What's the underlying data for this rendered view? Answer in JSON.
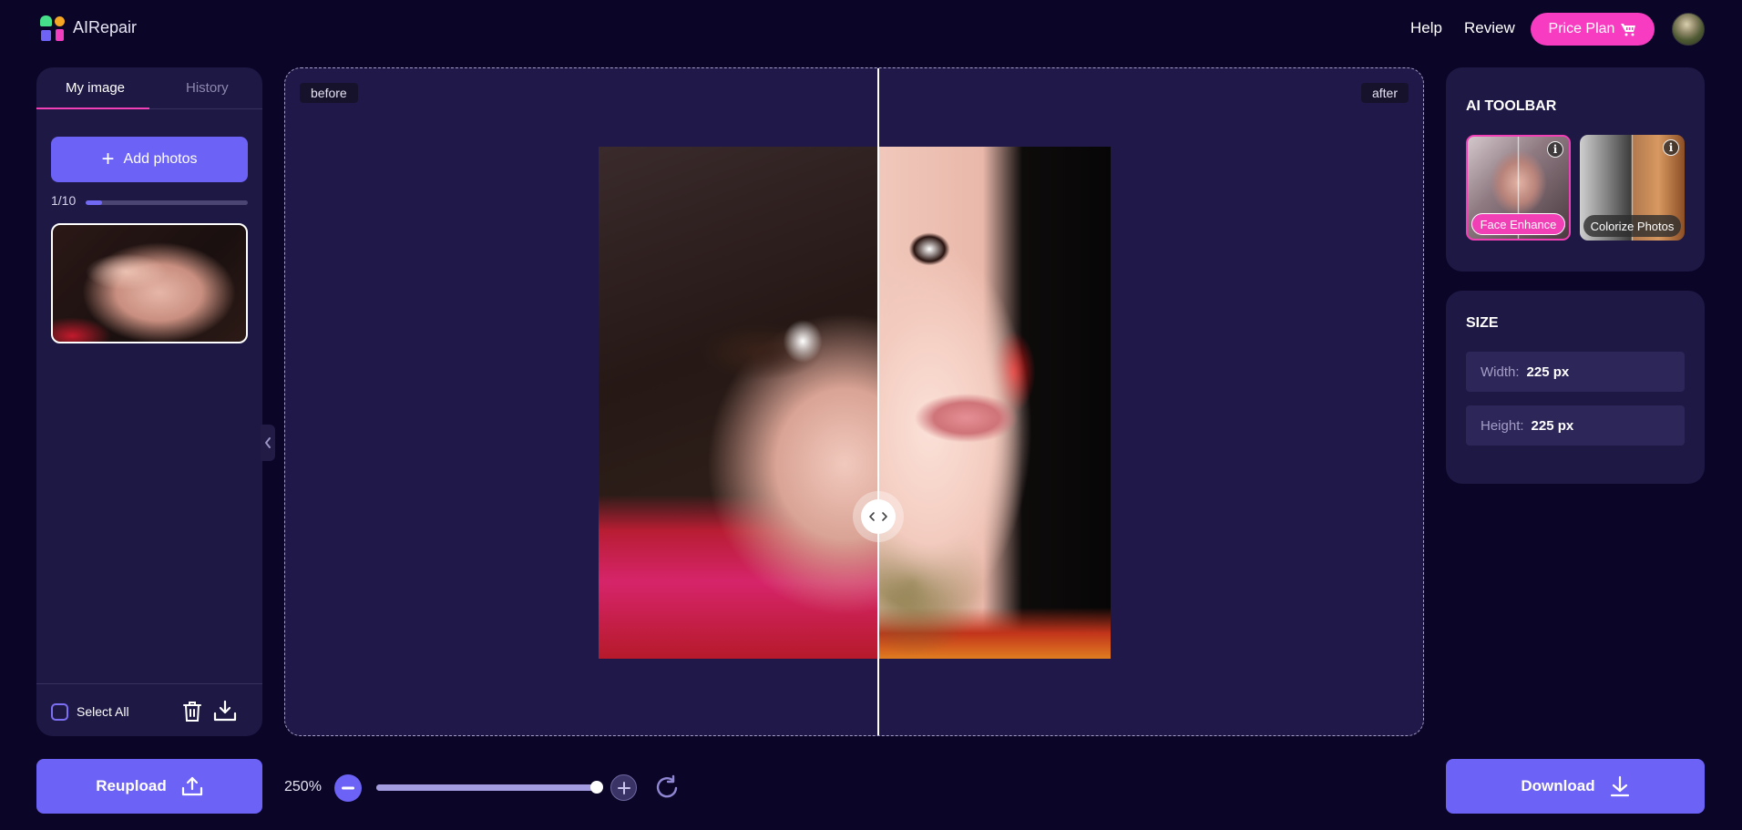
{
  "app": {
    "name": "AIRepair",
    "logo_colors": {
      "triangle": "#46e08a",
      "circle": "#f5a623",
      "square": "#6f63f6",
      "bar": "#f23dc0"
    }
  },
  "header": {
    "nav": [
      {
        "label": "Help",
        "icon": null
      },
      {
        "label": "Review",
        "icon": null
      }
    ],
    "price_plan": {
      "label": "Price Plan",
      "icon": "cart-icon",
      "color": "#f83cc2"
    },
    "avatar_icon": "user-avatar"
  },
  "left_panel": {
    "tabs": [
      {
        "label": "My image",
        "active": true
      },
      {
        "label": "History",
        "active": false
      }
    ],
    "add_photos": {
      "label": "Add photos",
      "icon": "plus-icon"
    },
    "photo_count": {
      "text": "1/10",
      "used": 1,
      "max": 10
    },
    "thumbnails": [
      {
        "selected": true,
        "description": "noisy portrait of woman with dark hair"
      }
    ],
    "footer": {
      "select_all_label": "Select All",
      "select_all_checked": false,
      "actions": [
        "trash-icon",
        "download-icon"
      ]
    },
    "collapse_icon": "chevron-left-icon"
  },
  "compare": {
    "before_label": "before",
    "after_label": "after",
    "divider_position_percent": 54.6,
    "handle_icon": "chevron-left-right-icon"
  },
  "ai_toolbar": {
    "title": "AI TOOLBAR",
    "tools": [
      {
        "label": "Face Enhance",
        "selected": true,
        "icon": "info-icon"
      },
      {
        "label": "Colorize Photos",
        "selected": false,
        "icon": "info-icon"
      }
    ]
  },
  "size": {
    "title": "SIZE",
    "width_label": "Width:",
    "width_value": "225 px",
    "height_label": "Height:",
    "height_value": "225 px"
  },
  "bottom": {
    "reupload_label": "Reupload",
    "reupload_icon": "upload-icon",
    "zoom_text": "250%",
    "zoom_percent": 250,
    "zoom_slider_fraction": 1.0,
    "reset_icon": "rotate-icon",
    "download_label": "Download",
    "download_icon": "download-icon"
  },
  "colors": {
    "background": "#0b0627",
    "panel": "#1e1844",
    "accent": "#6c62f5",
    "pink": "#f13fb6"
  }
}
